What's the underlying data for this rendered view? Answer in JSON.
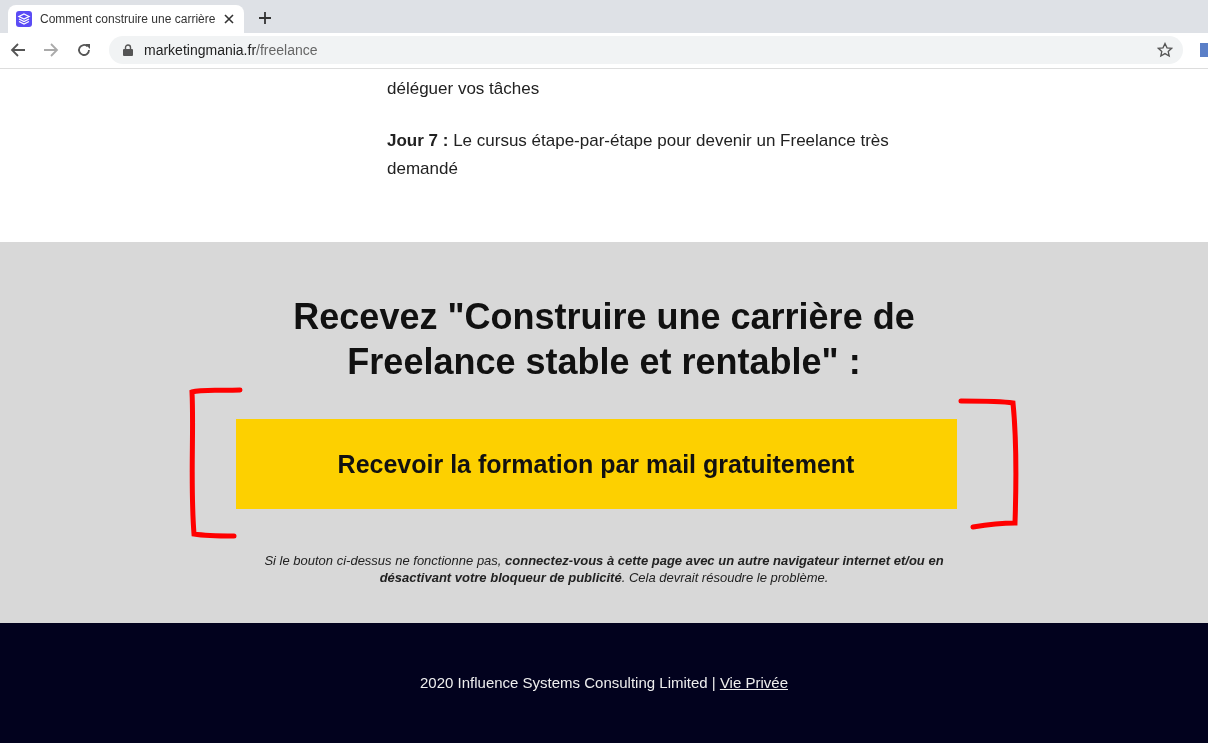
{
  "browser": {
    "tab": {
      "title": "Comment construire une carrière",
      "selected": true
    },
    "url": {
      "domain": "marketingmania.fr",
      "path": "/freelance"
    }
  },
  "article": {
    "paragraphs": [
      "déléguer vos tâches",
      "**Jour 7 :** Le cursus étape-par-étape pour devenir un Freelance très demandé"
    ]
  },
  "cta": {
    "title": "Recevez \"Construire une carrière de Freelance stable et rentable\" :",
    "button": "Recevoir la formation par mail gratuitement",
    "note": "Si le bouton ci-dessus ne fonctionne pas, **connectez-vous à cette page avec un autre navigateur internet et/ou en désactivant votre bloqueur de publicité**. Cela devrait résoudre le problème."
  },
  "footer": {
    "text": "2020 Influence Systems Consulting Limited | ",
    "link": "Vie Privée"
  }
}
